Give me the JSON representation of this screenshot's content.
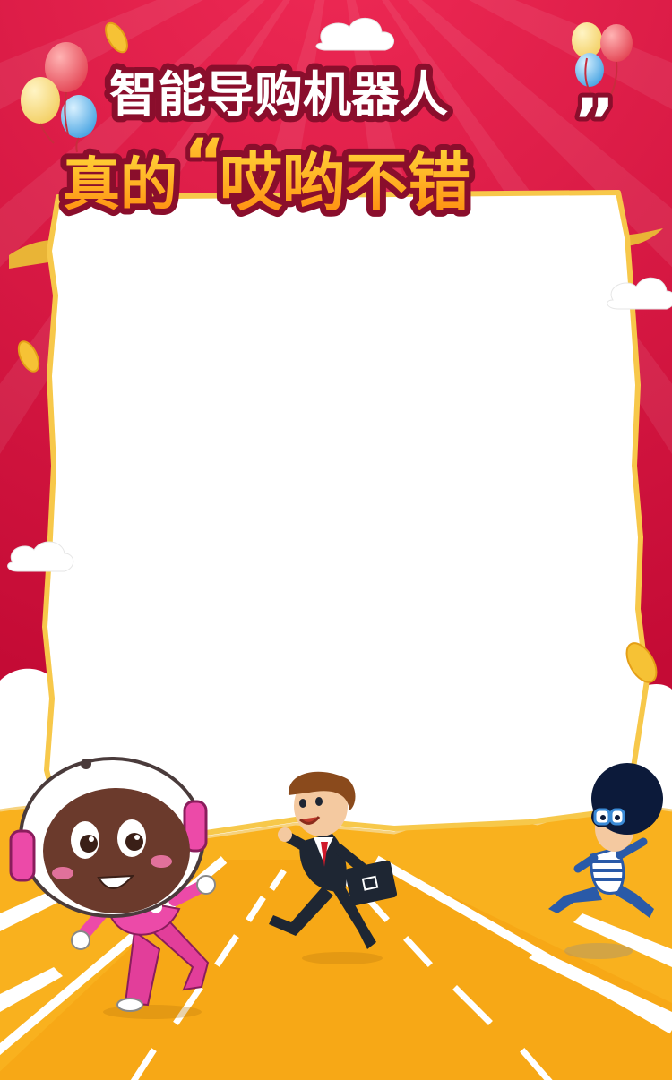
{
  "poster": {
    "headline_line1": "智能导购机器人",
    "headline_line2_prefix": "真的",
    "headline_line2_quoted": "哎哟不错",
    "open_quote": "“",
    "close_quote": "”"
  },
  "colors": {
    "background_red": "#d4113e",
    "road_yellow": "#f9b11e",
    "card_border": "#f7c84a",
    "headline_fill_white": "#ffffff",
    "headline_fill_orange": "#ff9c14",
    "headline_outline": "#8a0e2c"
  },
  "characters": [
    "robot-mascot",
    "businessman",
    "curly-haired-kid"
  ]
}
